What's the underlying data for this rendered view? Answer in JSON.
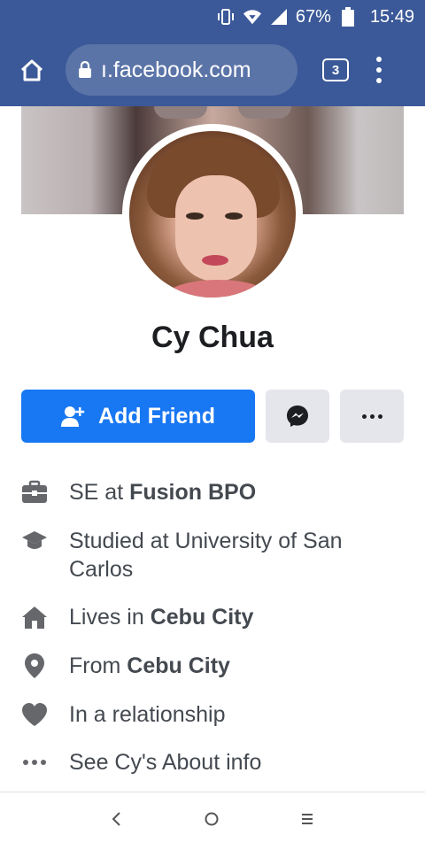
{
  "status_bar": {
    "battery_pct": "67%",
    "time": "15:49",
    "icons": [
      "vibrate-icon",
      "wifi-icon",
      "signal-icon",
      "battery-icon"
    ]
  },
  "browser": {
    "url": "ı.facebook.com",
    "tab_count": "3"
  },
  "profile": {
    "name": "Cy Chua"
  },
  "actions": {
    "add_friend_label": "Add Friend"
  },
  "details": {
    "work": {
      "prefix": "SE at ",
      "bold": "Fusion BPO"
    },
    "education": {
      "text": "Studied at University of San Carlos"
    },
    "lives": {
      "prefix": "Lives in ",
      "bold": "Cebu City"
    },
    "from": {
      "prefix": "From ",
      "bold": "Cebu City"
    },
    "relationship": {
      "text": "In a relationship"
    },
    "about": {
      "text": "See Cy's About info"
    }
  },
  "colors": {
    "fb_blue": "#1877f2",
    "header": "#3b5998",
    "button_grey": "#e4e6eb"
  }
}
